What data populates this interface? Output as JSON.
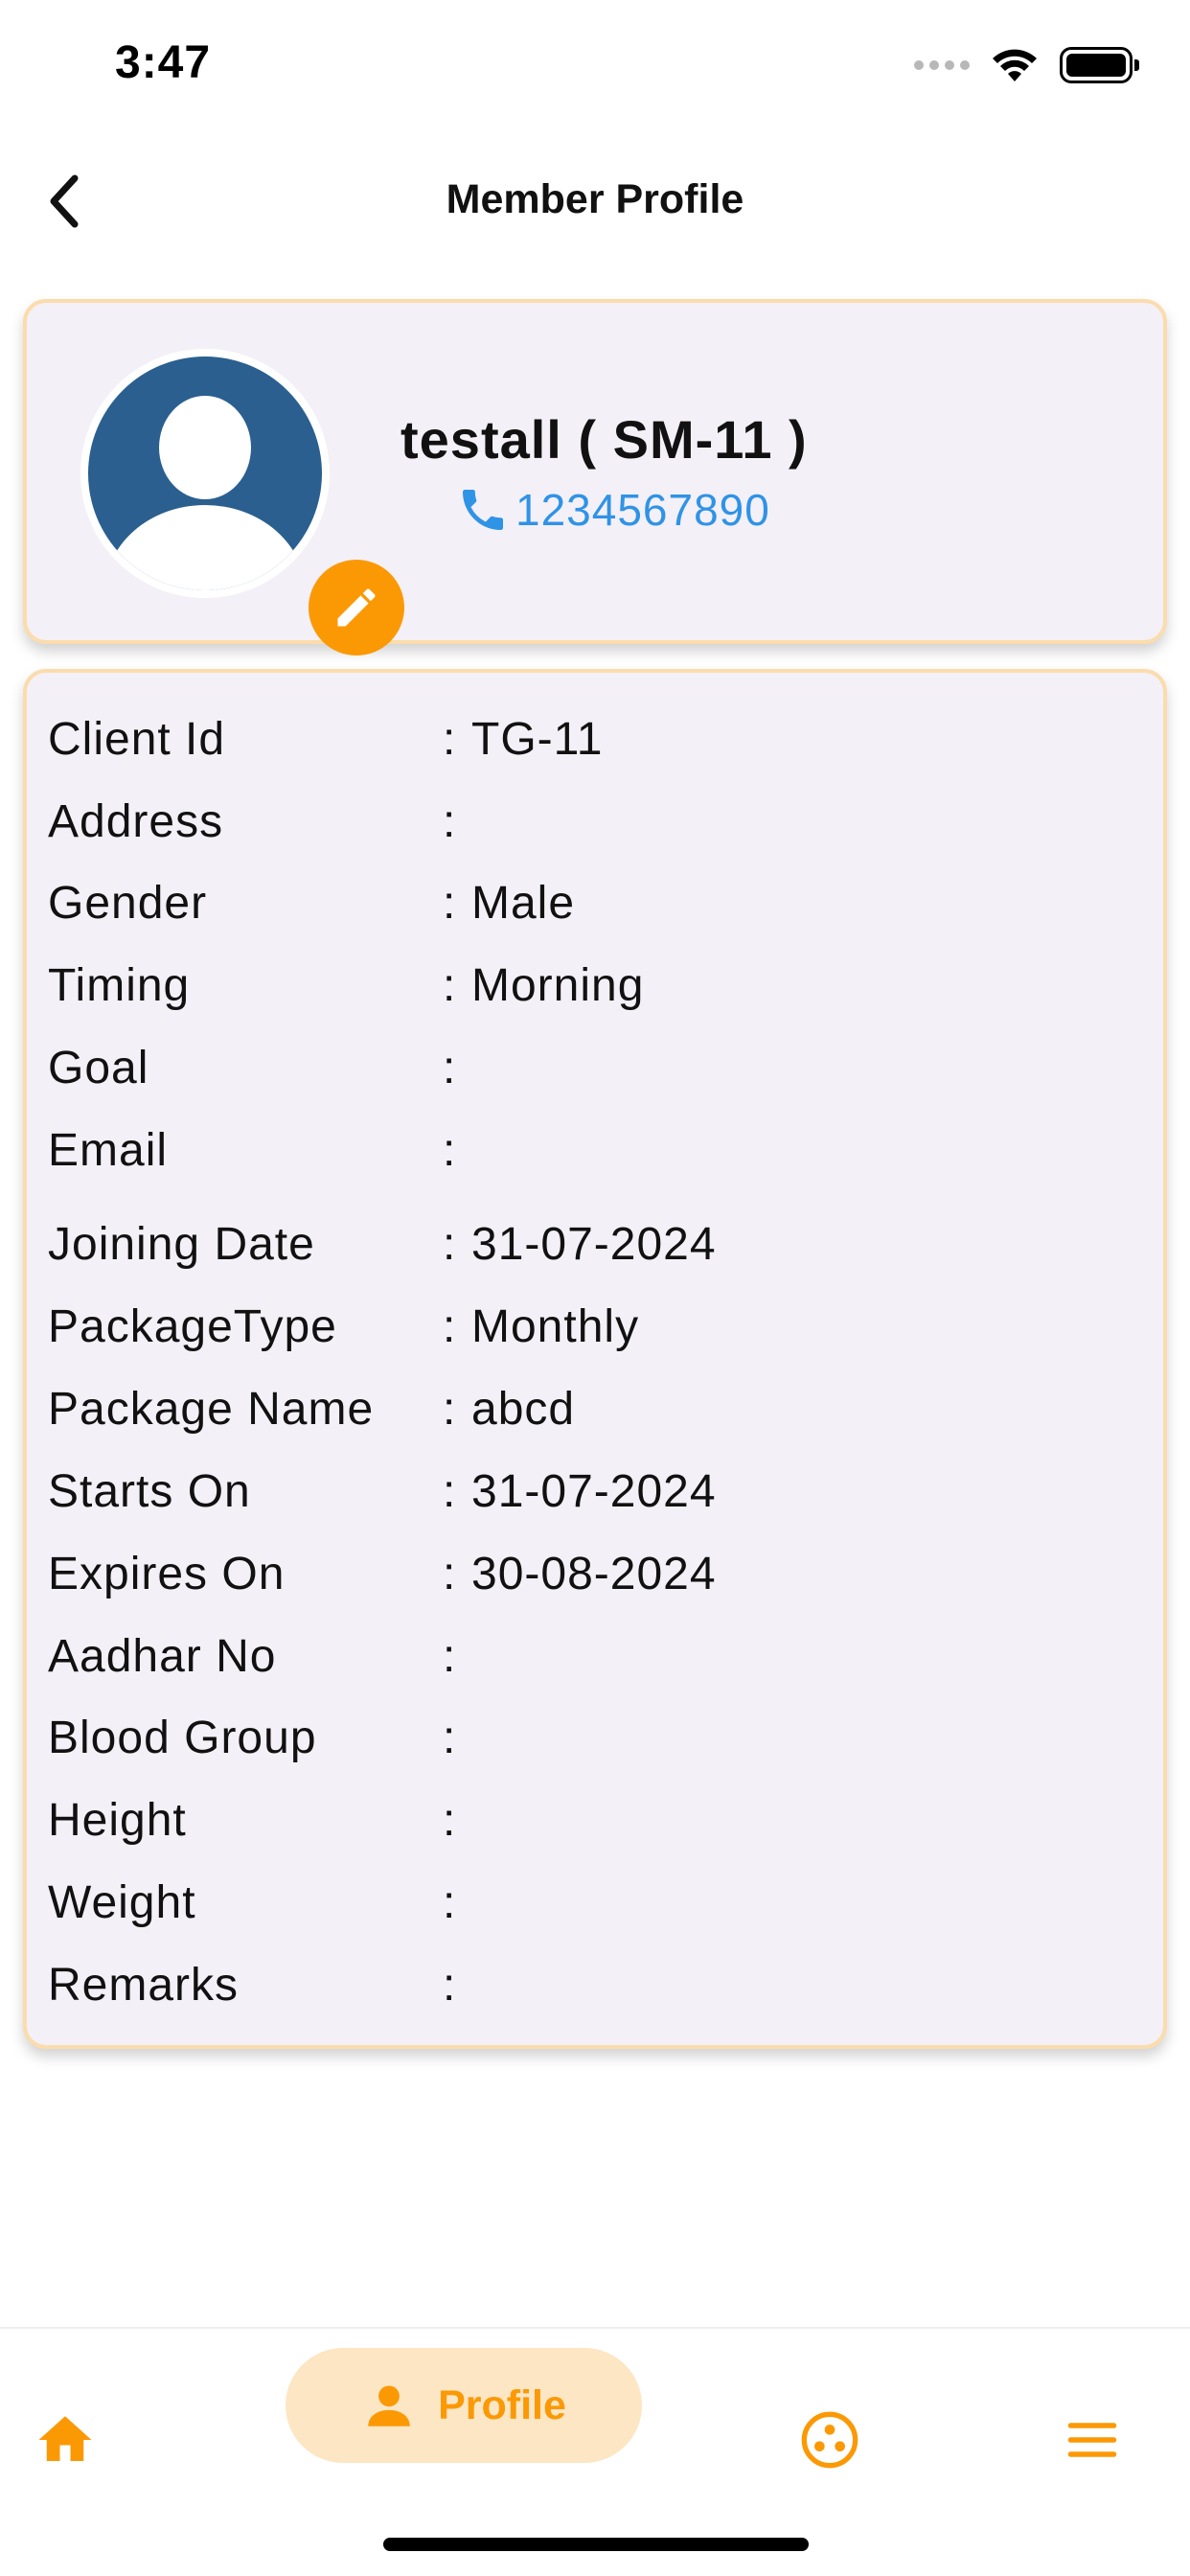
{
  "status_bar": {
    "time": "3:47",
    "icons": [
      "signal-icon",
      "wifi-icon",
      "battery-icon"
    ]
  },
  "header": {
    "title": "Member Profile",
    "back_icon": "chevron-left-icon"
  },
  "profile": {
    "name": "testall ( SM-11 )",
    "phone": "1234567890",
    "avatar_icon": "avatar-icon",
    "edit_icon": "pencil-icon",
    "phone_icon": "phone-icon"
  },
  "details": [
    {
      "label": "Client Id",
      "separator": ":",
      "value": "TG-11"
    },
    {
      "label": "Address",
      "separator": ":",
      "value": ""
    },
    {
      "label": "Gender",
      "separator": ":",
      "value": "Male"
    },
    {
      "label": "Timing",
      "separator": ":",
      "value": "Morning"
    },
    {
      "label": "Goal",
      "separator": ":",
      "value": ""
    },
    {
      "label": "Email",
      "separator": ":",
      "value": ""
    },
    {
      "label": "Joining Date",
      "separator": ":",
      "value": "31-07-2024"
    },
    {
      "label": "PackageType",
      "separator": ":",
      "value": "Monthly"
    },
    {
      "label": "Package Name",
      "separator": ":",
      "value": "abcd"
    },
    {
      "label": "Starts On",
      "separator": ":",
      "value": "31-07-2024"
    },
    {
      "label": "Expires On",
      "separator": ":",
      "value": "30-08-2024"
    },
    {
      "label": "Aadhar No",
      "separator": ":",
      "value": ""
    },
    {
      "label": "Blood Group",
      "separator": ":",
      "value": ""
    },
    {
      "label": "Height",
      "separator": ":",
      "value": ""
    },
    {
      "label": "Weight",
      "separator": ":",
      "value": ""
    },
    {
      "label": "Remarks",
      "separator": ":",
      "value": ""
    }
  ],
  "bottom_nav": {
    "items": [
      {
        "icon": "home-icon",
        "label": ""
      },
      {
        "icon": "person-icon",
        "label": "Profile",
        "active": true
      },
      {
        "icon": "groups-icon",
        "label": ""
      },
      {
        "icon": "menu-icon",
        "label": ""
      }
    ]
  },
  "colors": {
    "accent": "#fb9905",
    "active_tab_bg": "#fde6c4",
    "card_bg": "#f4f0f7",
    "card_border": "#fbdcad",
    "avatar_blue": "#2a5f8f",
    "phone_blue": "#2f93e6"
  }
}
